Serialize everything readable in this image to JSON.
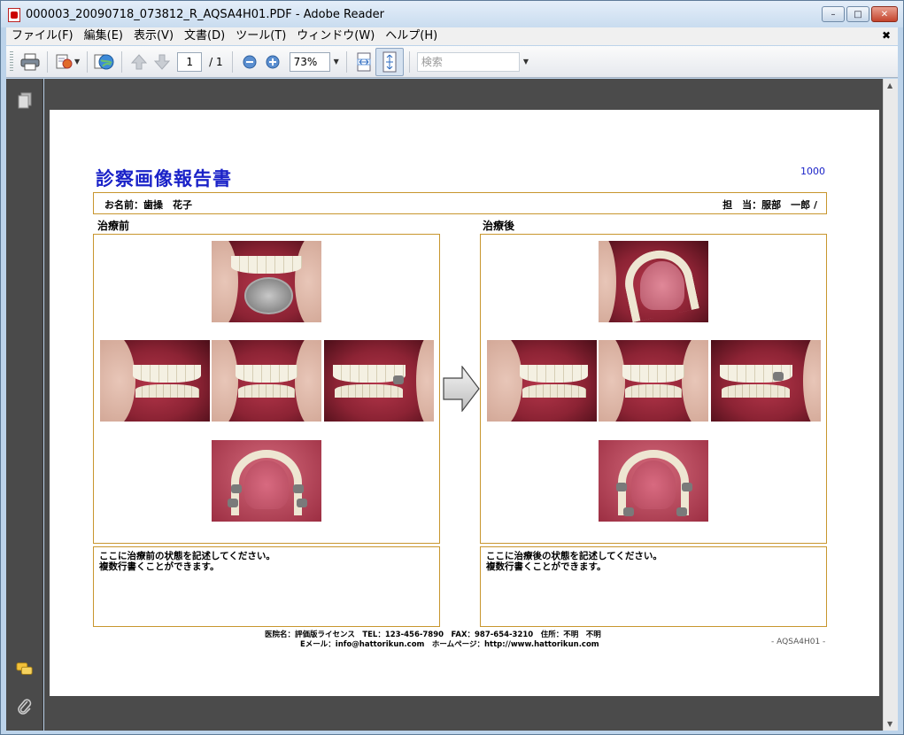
{
  "window": {
    "title": "000003_20090718_073812_R_AQSA4H01.PDF - Adobe Reader",
    "minimize": "–",
    "maximize": "□",
    "close": "✕"
  },
  "menubar": {
    "items": [
      "ファイル(F)",
      "編集(E)",
      "表示(V)",
      "文書(D)",
      "ツール(T)",
      "ウィンドウ(W)",
      "ヘルプ(H)"
    ],
    "close": "✖"
  },
  "toolbar": {
    "page_current": "1",
    "page_total": "/ 1",
    "zoom": "73%",
    "search_placeholder": "検索"
  },
  "report": {
    "title": "診察画像報告書",
    "number": "1000",
    "patient": "お名前：歯操　花子",
    "doctor": "担　当：服部　一郎 /",
    "before_label": "治療前",
    "after_label": "治療後",
    "before_note_line1": "ここに治療前の状態を記述してください。",
    "before_note_line2": "複数行書くことができます。",
    "after_note_line1": "ここに治療後の状態を記述してください。",
    "after_note_line2": "複数行書くことができます。",
    "footer_line1": "医院名：評価版ライセンス　TEL：123-456-7890　FAX：987-654-3210　住所：不明　不明",
    "footer_line2": "Eメール：info@hattorikun.com　ホームページ：http://www.hattorikun.com",
    "footer_code": "- AQSA4H01 -"
  },
  "colors": {
    "title_blue": "#1a22c8",
    "border_gold": "#c8962e",
    "doc_bg": "#4b4b4b"
  },
  "icons": [
    "print-icon",
    "sign-icon",
    "globe-share-icon",
    "page-up-icon",
    "page-down-icon",
    "zoom-out-icon",
    "zoom-in-icon",
    "fit-width-icon",
    "fit-page-icon",
    "pages-icon",
    "comments-icon",
    "attachment-icon"
  ]
}
